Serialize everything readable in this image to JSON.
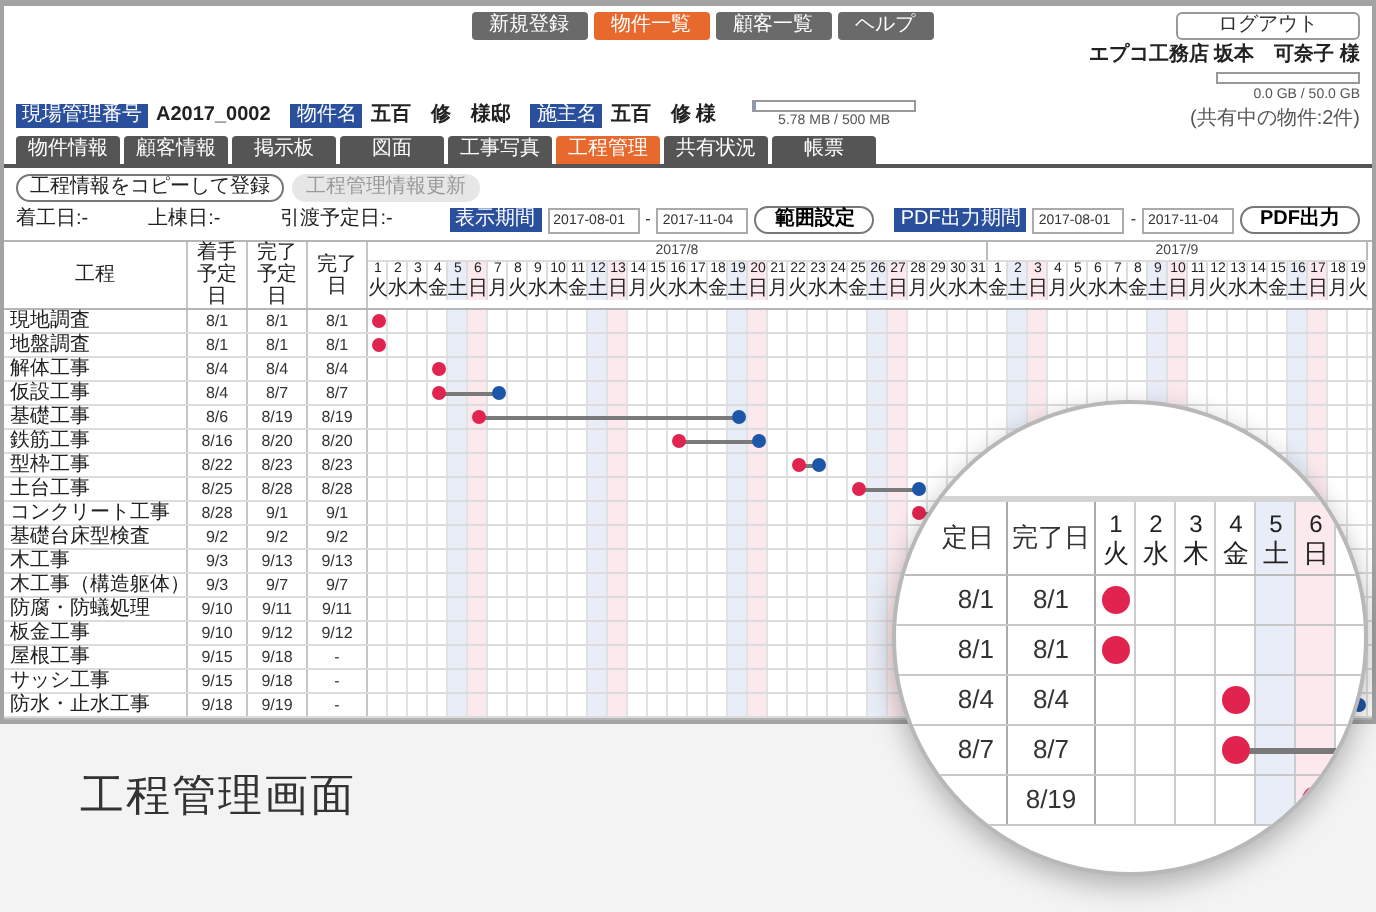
{
  "nav": {
    "links": [
      {
        "label": "新規登録",
        "selected": false
      },
      {
        "label": "物件一覧",
        "selected": true
      },
      {
        "label": "顧客一覧",
        "selected": false
      },
      {
        "label": "ヘルプ",
        "selected": false
      }
    ],
    "logout": "ログアウト",
    "user": "エプコ工務店 坂本　可奈子 様"
  },
  "storage": {
    "reading": "0.0 GB / 50.0 GB",
    "note": "(共有中の物件:2件)"
  },
  "project": {
    "fields": [
      {
        "label": "現場管理番号",
        "value": "A2017_0002"
      },
      {
        "label": "物件名",
        "value": "五百　修　様邸"
      },
      {
        "label": "施主名",
        "value": "五百　修 様"
      }
    ],
    "usage": {
      "level": 0.01,
      "reading": "5.78 MB / 500 MB"
    }
  },
  "tabs": [
    {
      "label": "物件情報",
      "selected": false
    },
    {
      "label": "顧客情報",
      "selected": false
    },
    {
      "label": "掲示板",
      "selected": false
    },
    {
      "label": "図面",
      "selected": false
    },
    {
      "label": "工事写真",
      "selected": false
    },
    {
      "label": "工程管理",
      "selected": true
    },
    {
      "label": "共有状況",
      "selected": false
    },
    {
      "label": "帳票",
      "selected": false
    }
  ],
  "actions": [
    {
      "label": "工程情報をコピーして登録",
      "disabled": false
    },
    {
      "label": "工程管理情報更新",
      "disabled": true
    }
  ],
  "milestones": [
    "着工日:-",
    "上棟日:-",
    "引渡予定日:-"
  ],
  "ranges": [
    {
      "label": "表示期間",
      "from": "2017-08-01",
      "separator": "-",
      "to": "2017-11-04",
      "button": "範囲設定"
    },
    {
      "label": "PDF出力期間",
      "from": "2017-08-01",
      "separator": "-",
      "to": "2017-11-04",
      "button": "PDF出力"
    }
  ],
  "table": {
    "columns": [
      "工程",
      "着手予定日",
      "完了予定日",
      "完了日"
    ],
    "months": [
      {
        "label": "2017/8",
        "days": [
          {
            "day": "1",
            "weekday": "火",
            "kind": "weekday"
          },
          {
            "day": "2",
            "weekday": "水",
            "kind": "weekday"
          },
          {
            "day": "3",
            "weekday": "木",
            "kind": "weekday"
          },
          {
            "day": "4",
            "weekday": "金",
            "kind": "weekday"
          },
          {
            "day": "5",
            "weekday": "土",
            "kind": "saturday"
          },
          {
            "day": "6",
            "weekday": "日",
            "kind": "sunday"
          },
          {
            "day": "7",
            "weekday": "月",
            "kind": "weekday"
          },
          {
            "day": "8",
            "weekday": "火",
            "kind": "weekday"
          },
          {
            "day": "9",
            "weekday": "水",
            "kind": "weekday"
          },
          {
            "day": "10",
            "weekday": "木",
            "kind": "weekday"
          },
          {
            "day": "11",
            "weekday": "金",
            "kind": "weekday"
          },
          {
            "day": "12",
            "weekday": "土",
            "kind": "saturday"
          },
          {
            "day": "13",
            "weekday": "日",
            "kind": "sunday"
          },
          {
            "day": "14",
            "weekday": "月",
            "kind": "weekday"
          },
          {
            "day": "15",
            "weekday": "火",
            "kind": "weekday"
          },
          {
            "day": "16",
            "weekday": "水",
            "kind": "weekday"
          },
          {
            "day": "17",
            "weekday": "木",
            "kind": "weekday"
          },
          {
            "day": "18",
            "weekday": "金",
            "kind": "weekday"
          },
          {
            "day": "19",
            "weekday": "土",
            "kind": "saturday"
          },
          {
            "day": "20",
            "weekday": "日",
            "kind": "sunday"
          },
          {
            "day": "21",
            "weekday": "月",
            "kind": "weekday"
          },
          {
            "day": "22",
            "weekday": "火",
            "kind": "weekday"
          },
          {
            "day": "23",
            "weekday": "水",
            "kind": "weekday"
          },
          {
            "day": "24",
            "weekday": "木",
            "kind": "weekday"
          },
          {
            "day": "25",
            "weekday": "金",
            "kind": "weekday"
          },
          {
            "day": "26",
            "weekday": "土",
            "kind": "saturday"
          },
          {
            "day": "27",
            "weekday": "日",
            "kind": "sunday"
          },
          {
            "day": "28",
            "weekday": "月",
            "kind": "weekday"
          },
          {
            "day": "29",
            "weekday": "火",
            "kind": "weekday"
          },
          {
            "day": "30",
            "weekday": "水",
            "kind": "weekday"
          },
          {
            "day": "31",
            "weekday": "木",
            "kind": "weekday"
          }
        ]
      },
      {
        "label": "2017/9",
        "days": [
          {
            "day": "1",
            "weekday": "金",
            "kind": "weekday"
          },
          {
            "day": "2",
            "weekday": "土",
            "kind": "saturday"
          },
          {
            "day": "3",
            "weekday": "日",
            "kind": "sunday"
          },
          {
            "day": "4",
            "weekday": "月",
            "kind": "weekday"
          },
          {
            "day": "5",
            "weekday": "火",
            "kind": "weekday"
          },
          {
            "day": "6",
            "weekday": "水",
            "kind": "weekday"
          },
          {
            "day": "7",
            "weekday": "木",
            "kind": "weekday"
          },
          {
            "day": "8",
            "weekday": "金",
            "kind": "weekday"
          },
          {
            "day": "9",
            "weekday": "土",
            "kind": "saturday"
          },
          {
            "day": "10",
            "weekday": "日",
            "kind": "sunday"
          },
          {
            "day": "11",
            "weekday": "月",
            "kind": "weekday"
          },
          {
            "day": "12",
            "weekday": "火",
            "kind": "weekday"
          },
          {
            "day": "13",
            "weekday": "水",
            "kind": "weekday"
          },
          {
            "day": "14",
            "weekday": "木",
            "kind": "weekday"
          },
          {
            "day": "15",
            "weekday": "金",
            "kind": "weekday"
          },
          {
            "day": "16",
            "weekday": "土",
            "kind": "saturday"
          },
          {
            "day": "17",
            "weekday": "日",
            "kind": "sunday"
          },
          {
            "day": "18",
            "weekday": "月",
            "kind": "weekday"
          },
          {
            "day": "19",
            "weekday": "火",
            "kind": "weekday"
          }
        ]
      }
    ],
    "rows": [
      {
        "name": "現地調査",
        "start": "8/1",
        "planned_end": "8/1",
        "done": "8/1"
      },
      {
        "name": "地盤調査",
        "start": "8/1",
        "planned_end": "8/1",
        "done": "8/1"
      },
      {
        "name": "解体工事",
        "start": "8/4",
        "planned_end": "8/4",
        "done": "8/4"
      },
      {
        "name": "仮設工事",
        "start": "8/4",
        "planned_end": "8/7",
        "done": "8/7"
      },
      {
        "name": "基礎工事",
        "start": "8/6",
        "planned_end": "8/19",
        "done": "8/19"
      },
      {
        "name": "鉄筋工事",
        "start": "8/16",
        "planned_end": "8/20",
        "done": "8/20"
      },
      {
        "name": "型枠工事",
        "start": "8/22",
        "planned_end": "8/23",
        "done": "8/23"
      },
      {
        "name": "土台工事",
        "start": "8/25",
        "planned_end": "8/28",
        "done": "8/28"
      },
      {
        "name": "コンクリート工事",
        "start": "8/28",
        "planned_end": "9/1",
        "done": "9/1"
      },
      {
        "name": "基礎台床型検査",
        "start": "9/2",
        "planned_end": "9/2",
        "done": "9/2"
      },
      {
        "name": "木工事",
        "start": "9/3",
        "planned_end": "9/13",
        "done": "9/13"
      },
      {
        "name": "木工事（構造躯体）",
        "start": "9/3",
        "planned_end": "9/7",
        "done": "9/7"
      },
      {
        "name": "防腐・防蟻処理",
        "start": "9/10",
        "planned_end": "9/11",
        "done": "9/11"
      },
      {
        "name": "板金工事",
        "start": "9/10",
        "planned_end": "9/12",
        "done": "9/12"
      },
      {
        "name": "屋根工事",
        "start": "9/15",
        "planned_end": "9/18",
        "done": "-"
      },
      {
        "name": "サッシ工事",
        "start": "9/15",
        "planned_end": "9/18",
        "done": "-"
      },
      {
        "name": "防水・止水工事",
        "start": "9/18",
        "planned_end": "9/19",
        "done": "-"
      }
    ]
  },
  "magnifier": {
    "columns": [
      "定日",
      "完了日"
    ],
    "days": [
      {
        "day": "1",
        "weekday": "火",
        "kind": "weekday"
      },
      {
        "day": "2",
        "weekday": "水",
        "kind": "weekday"
      },
      {
        "day": "3",
        "weekday": "木",
        "kind": "weekday"
      },
      {
        "day": "4",
        "weekday": "金",
        "kind": "weekday"
      },
      {
        "day": "5",
        "weekday": "土",
        "kind": "saturday"
      },
      {
        "day": "6",
        "weekday": "日",
        "kind": "sunday"
      }
    ],
    "rows": [
      {
        "start": "8/1",
        "end": "8/1"
      },
      {
        "start": "8/1",
        "end": "8/1"
      },
      {
        "start": "8/4",
        "end": "8/4"
      },
      {
        "start": "8/7",
        "end": "8/7"
      },
      {
        "end": "8/19"
      }
    ]
  },
  "caption": "工程管理画面"
}
